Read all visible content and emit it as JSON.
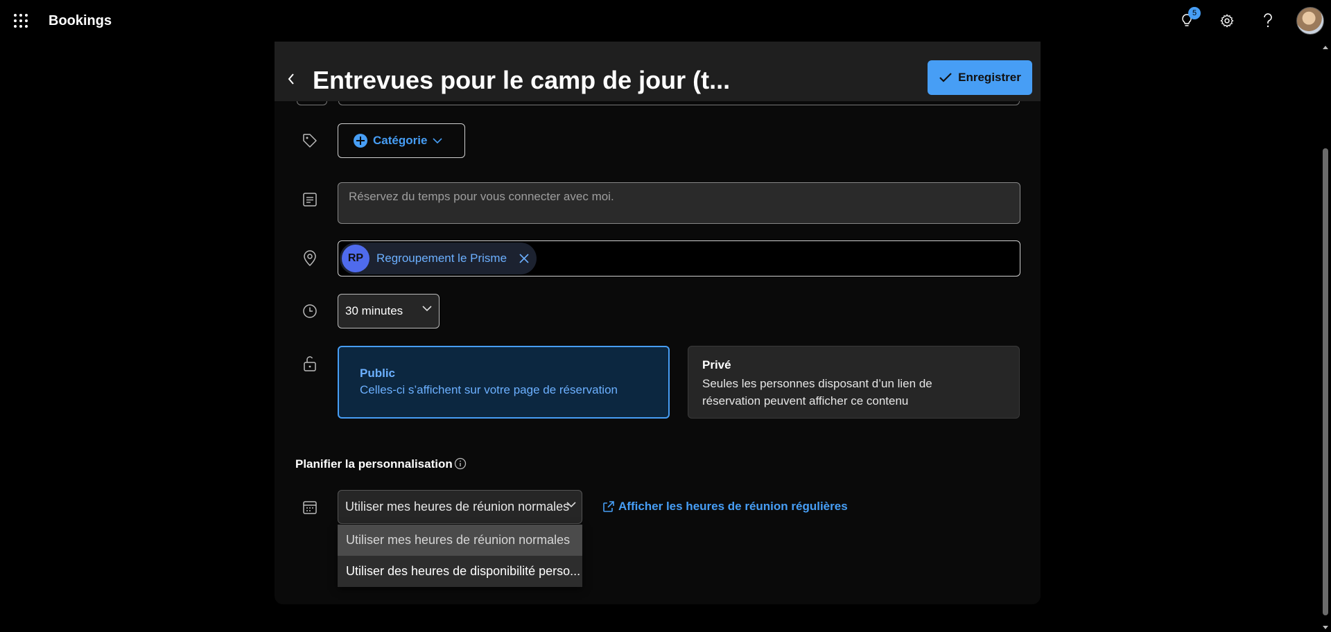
{
  "app": {
    "name": "Bookings"
  },
  "topbar": {
    "notification_count": "5"
  },
  "editor": {
    "title": "Entrevues pour le camp de jour (t...",
    "save_label": "Enregistrer",
    "category_label": "Catégorie",
    "description_placeholder": "Réservez du temps pour vous connecter avec moi.",
    "location": {
      "initials": "RP",
      "name": "Regroupement le Prisme"
    },
    "duration": "30 minutes",
    "visibility": {
      "public_title": "Public",
      "public_desc": "Celles-ci s’affichent sur votre page de réservation",
      "private_title": "Privé",
      "private_desc": "Seules les personnes disposant d’un lien de réservation peuvent afficher ce contenu",
      "selected": "public"
    },
    "schedule": {
      "section_label": "Planifier la personnalisation",
      "selected": "Utiliser mes heures de réunion normales",
      "link_label": "Afficher les heures de réunion régulières",
      "options": [
        "Utiliser mes heures de réunion normales",
        "Utiliser des heures de disponibilité perso..."
      ]
    }
  },
  "colors": {
    "accent": "#479ef5",
    "background": "#000000",
    "panel": "#0a0a0a"
  }
}
